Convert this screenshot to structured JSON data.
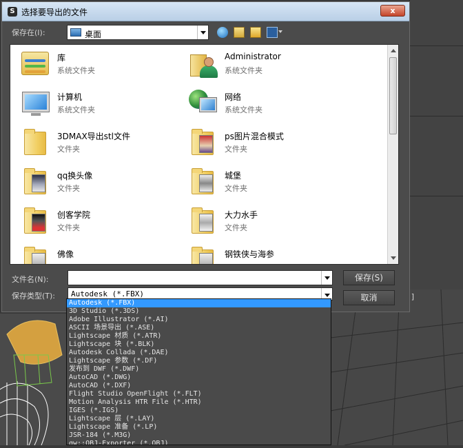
{
  "dialog": {
    "title": "选择要导出的文件",
    "close_label": "x",
    "save_in_label": "保存在(I):",
    "save_in_value": "桌面",
    "file_name_label": "文件名(N):",
    "file_name_value": "",
    "file_type_label": "保存类型(T):",
    "file_type_value": "Autodesk (*.FBX)",
    "save_button": "保存(S)",
    "cancel_button": "取消"
  },
  "files": [
    {
      "name": "库",
      "type": "系统文件夹",
      "icon": "library-icon"
    },
    {
      "name": "Administrator",
      "type": "系统文件夹",
      "icon": "user-folder-icon"
    },
    {
      "name": "计算机",
      "type": "系统文件夹",
      "icon": "computer-icon"
    },
    {
      "name": "网络",
      "type": "系统文件夹",
      "icon": "network-icon"
    },
    {
      "name": "3DMAX导出stl文件",
      "type": "文件夹",
      "icon": "folder-icon"
    },
    {
      "name": "ps图片混合模式",
      "type": "文件夹",
      "icon": "folder-icon"
    },
    {
      "name": "qq换头像",
      "type": "文件夹",
      "icon": "folder-icon"
    },
    {
      "name": "城堡",
      "type": "文件夹",
      "icon": "folder-icon"
    },
    {
      "name": "创客学院",
      "type": "文件夹",
      "icon": "folder-icon"
    },
    {
      "name": "大力水手",
      "type": "文件夹",
      "icon": "folder-icon"
    },
    {
      "name": "佛像",
      "type": "",
      "icon": "folder-icon"
    },
    {
      "name": "钢铁侠与海参",
      "type": "",
      "icon": "folder-icon"
    }
  ],
  "file_types": [
    "Autodesk (*.FBX)",
    "3D Studio (*.3DS)",
    "Adobe Illustrator (*.AI)",
    "ASCII 场景导出 (*.ASE)",
    "Lightscape 材质 (*.ATR)",
    "Lightscape 块 (*.BLK)",
    "Autodesk Collada (*.DAE)",
    "Lightscape 参数 (*.DF)",
    "发布到 DWF (*.DWF)",
    "AutoCAD (*.DWG)",
    "AutoCAD (*.DXF)",
    "Flight Studio OpenFlight (*.FLT)",
    "Motion Analysis HTR File (*.HTR)",
    "IGES (*.IGS)",
    "Lightscape 层 (*.LAY)",
    "Lightscape 准备 (*.LP)",
    "JSR-184 (*.M3G)",
    "gw::OBJ-Exporter (*.OBJ)"
  ],
  "viewport_label": "]",
  "colors": {
    "title_bar": "#c7dcf0",
    "selection": "#3399ff",
    "dropdown_bg": "#4a4a4a"
  }
}
